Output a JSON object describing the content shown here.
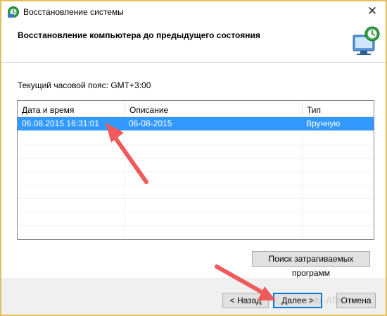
{
  "window": {
    "title": "Восстановление системы",
    "close_glyph": "✕"
  },
  "header": {
    "title": "Восстановление компьютера до предыдущего состояния",
    "icon": "system-restore-icon"
  },
  "timezone": {
    "label": "Текущий часовой пояс: GMT+3:00"
  },
  "table": {
    "columns": [
      "Дата и время",
      "Описание",
      "Тип"
    ],
    "rows": [
      {
        "date": "06.08.2015 16:31:01",
        "description": "06-08-2015",
        "type": "Вручную",
        "selected": true
      }
    ]
  },
  "buttons": {
    "scan": "Поиск затрагиваемых программ",
    "back": "< Назад",
    "next": "Далее >",
    "cancel": "Отмена"
  },
  "watermark": "user-life.com",
  "colors": {
    "selection": "#3399ff",
    "annotation_arrow": "#f05a5a",
    "frame_border": "#e3c05a"
  }
}
